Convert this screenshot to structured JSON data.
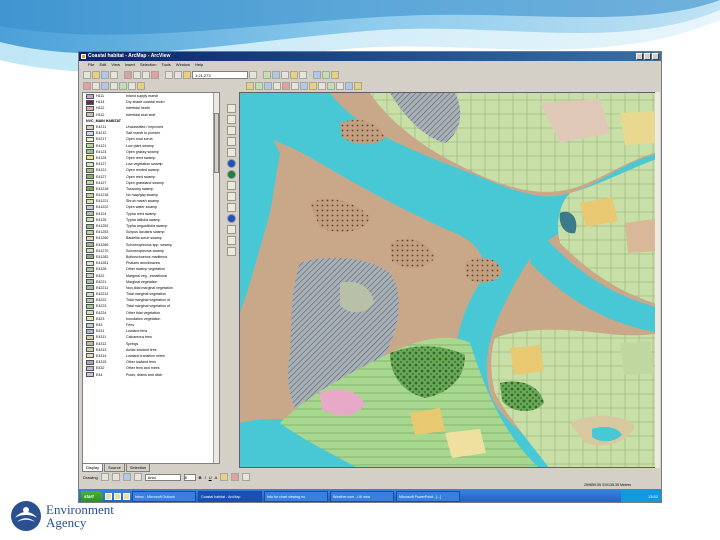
{
  "window": {
    "title": "Coastal habitat - ArcMap - ArcView"
  },
  "menu": [
    "File",
    "Edit",
    "View",
    "Insert",
    "Selection",
    "Tools",
    "Window",
    "Help"
  ],
  "toolbar": {
    "scale_value": "1:21,273"
  },
  "toc": {
    "rows": [
      {
        "code": "H111",
        "desc": "Inland supply marsh",
        "color": "#c8a0d0"
      },
      {
        "code": "H114",
        "desc": "Dry shade coastal reclm",
        "color": "#603050"
      },
      {
        "code": "H112",
        "desc": "Intertidal heath",
        "color": "#e0b0b0"
      },
      {
        "code": "H112",
        "desc": "Intertidal stub seaf",
        "color": "#d0c0b0"
      },
      {
        "code": "",
        "desc": "NVC_MAIN HABITAT",
        "color": ""
      },
      {
        "code": "E4211",
        "desc": "Unclassified / improved",
        "color": "#d8d0b8"
      },
      {
        "code": "E4212",
        "desc": "Salt marsh to pioneer",
        "color": "#c0e0f0"
      },
      {
        "code": "E4217",
        "desc": "Open mud scrub",
        "color": "#f0f0c0"
      },
      {
        "code": "E4121",
        "desc": "Low plant swamp",
        "color": "#b0d8a0"
      },
      {
        "code": "E4123",
        "desc": "Open grassy swamp",
        "color": "#90c888"
      },
      {
        "code": "E4125",
        "desc": "Open reed swamp",
        "color": "#e8e090"
      },
      {
        "code": "E4127",
        "desc": "Low vegetation swamp",
        "color": "#d0e8c0"
      },
      {
        "code": "E4121",
        "desc": "Open reeded swamp",
        "color": "#a0c080"
      },
      {
        "code": "E4127",
        "desc": "Open reed swamp",
        "color": "#88b070"
      },
      {
        "code": "E4127",
        "desc": "Open grassland swamp",
        "color": "#c0d8a0"
      },
      {
        "code": "E41218",
        "desc": "Tussocky swamp",
        "color": "#78a860"
      },
      {
        "code": "E41218",
        "desc": "No map/gap swamp",
        "color": "#b8d890"
      },
      {
        "code": "E41221",
        "desc": "Shrub marsh swamp",
        "color": "#e0e0a0"
      },
      {
        "code": "E41222",
        "desc": "Open water swamp",
        "color": "#c8c8e8"
      },
      {
        "code": "E4124",
        "desc": "Typha reed swamp",
        "color": "#a8c8a0"
      },
      {
        "code": "E4125",
        "desc": "Typha latifolia swamp",
        "color": "#d0e0b0"
      },
      {
        "code": "E41252",
        "desc": "Typha angustifolia swamp",
        "color": "#98b888"
      },
      {
        "code": "E41253",
        "desc": "Scirpus lacustris swamp",
        "color": "#b8d0a8"
      },
      {
        "code": "E41260",
        "desc": "Baldellia scrub swamp",
        "color": "#e8d8b0"
      },
      {
        "code": "E41265",
        "desc": "Schoenoplectus spp. swamp",
        "color": "#a0b890"
      },
      {
        "code": "E41270",
        "desc": "Schoenoplectus swamp",
        "color": "#c8e0b8"
      },
      {
        "code": "E41282",
        "desc": "Bolboschoenus maritimus",
        "color": "#90a880"
      },
      {
        "code": "E41281",
        "desc": "Phalaris arundinacea",
        "color": "#d8e8c8"
      },
      {
        "code": "E4128",
        "desc": "Other swamp vegetation",
        "color": "#b0c8a0"
      },
      {
        "code": "E422",
        "desc": "Marginal veg., transitional",
        "color": "#c0d8b8"
      },
      {
        "code": "E4221",
        "desc": "Marginal vegetation",
        "color": "#a8c0a0"
      },
      {
        "code": "E42211",
        "desc": "Non-tidal marginal vegetation",
        "color": "#98c090"
      },
      {
        "code": "E42212",
        "desc": "Tidal marginal vegetation",
        "color": "#c8e0c0"
      },
      {
        "code": "E4222",
        "desc": "Tidal marginal vegetation of",
        "color": "#b0d0a8"
      },
      {
        "code": "E4223",
        "desc": "Tidal marginal vegetation of",
        "color": "#a0c898"
      },
      {
        "code": "E4224",
        "desc": "Other tidal vegetation",
        "color": "#d0e0c0"
      },
      {
        "code": "E423",
        "desc": "Inundation vegetation",
        "color": "#e8e8b0"
      },
      {
        "code": "E43",
        "desc": "Fens",
        "color": "#c0c8e0"
      },
      {
        "code": "E431",
        "desc": "Lowland fens",
        "color": "#a8b8d8"
      },
      {
        "code": "E4311",
        "desc": "Calcareous fens",
        "color": "#d8d0a8"
      },
      {
        "code": "E4312",
        "desc": "Springs",
        "color": "#b8c0a0"
      },
      {
        "code": "E4313",
        "desc": "Acidic lowland fens",
        "color": "#c8d0b0"
      },
      {
        "code": "E4314",
        "desc": "Lowland transition mires",
        "color": "#e0d8b8"
      },
      {
        "code": "E4315",
        "desc": "Other lowland fens",
        "color": "#a0a8c0"
      },
      {
        "code": "E432",
        "desc": "Other fens and mires",
        "color": "#c8b8d8"
      },
      {
        "code": "E44",
        "desc": "Pools, drains and ditch",
        "color": "#d0c0e0"
      }
    ],
    "tabs": [
      "Display",
      "Source",
      "Selection"
    ]
  },
  "draw": {
    "label": "Drawing",
    "font": "Arial",
    "size": "8",
    "bold": "B",
    "italic": "I",
    "underline": "U",
    "font_color_glyph": "A"
  },
  "status": {
    "text": "259659.55  310135.35 Meters"
  },
  "taskbar": {
    "start": "start",
    "tasks": [
      "Inbox - Microsoft Outlook",
      "Coastal habitat - ArcMap",
      "Info for chart viewing no",
      "Weather.com - UK wea",
      "Microsoft PowerPoint - [...]"
    ],
    "clock": "13:52"
  },
  "logo": {
    "line1": "Environment",
    "line2": "Agency"
  },
  "colors": {
    "water": "#48c8d4",
    "mud": "#c8a888",
    "marsh": "#b8d8a0",
    "field": "#d8e8c0",
    "woodland": "#4a8a3c",
    "title_blue": "#0a246a",
    "taskbar_blue": "#2a6ad0",
    "logo_blue": "#2a5090"
  }
}
